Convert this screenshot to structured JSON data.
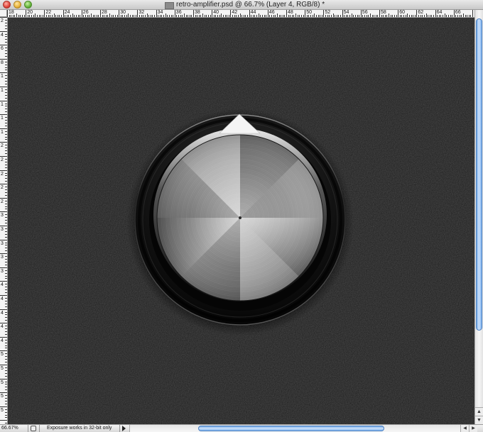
{
  "window": {
    "title": "retro-amplifier.psd @ 66.7% (Layer 4, RGB/8) *"
  },
  "ruler_top_labels": [
    "18",
    "20",
    "22",
    "24",
    "26",
    "28",
    "30",
    "32",
    "34",
    "36",
    "38",
    "40",
    "42",
    "44",
    "46",
    "48",
    "50",
    "52",
    "54",
    "56",
    "58",
    "60",
    "62",
    "64",
    "66"
  ],
  "ruler_left_labels": [
    "2",
    "4",
    "6",
    "8",
    "1",
    "1",
    "1",
    "1",
    "1",
    "2",
    "2",
    "2",
    "2",
    "2",
    "3",
    "3",
    "3",
    "3",
    "3",
    "4",
    "4",
    "4",
    "4",
    "4",
    "5",
    "5",
    "5",
    "5",
    "5"
  ],
  "status": {
    "zoom": "66.67%",
    "info": "Exposure works in 32-bit only"
  },
  "colors": {
    "canvas_background": "#1d1d1d",
    "scroll_thumb": "#7fb3ef"
  },
  "icons": [
    "close-button-icon",
    "minimize-button-icon",
    "zoom-button-icon",
    "document-icon",
    "status-menu-arrow-icon"
  ]
}
